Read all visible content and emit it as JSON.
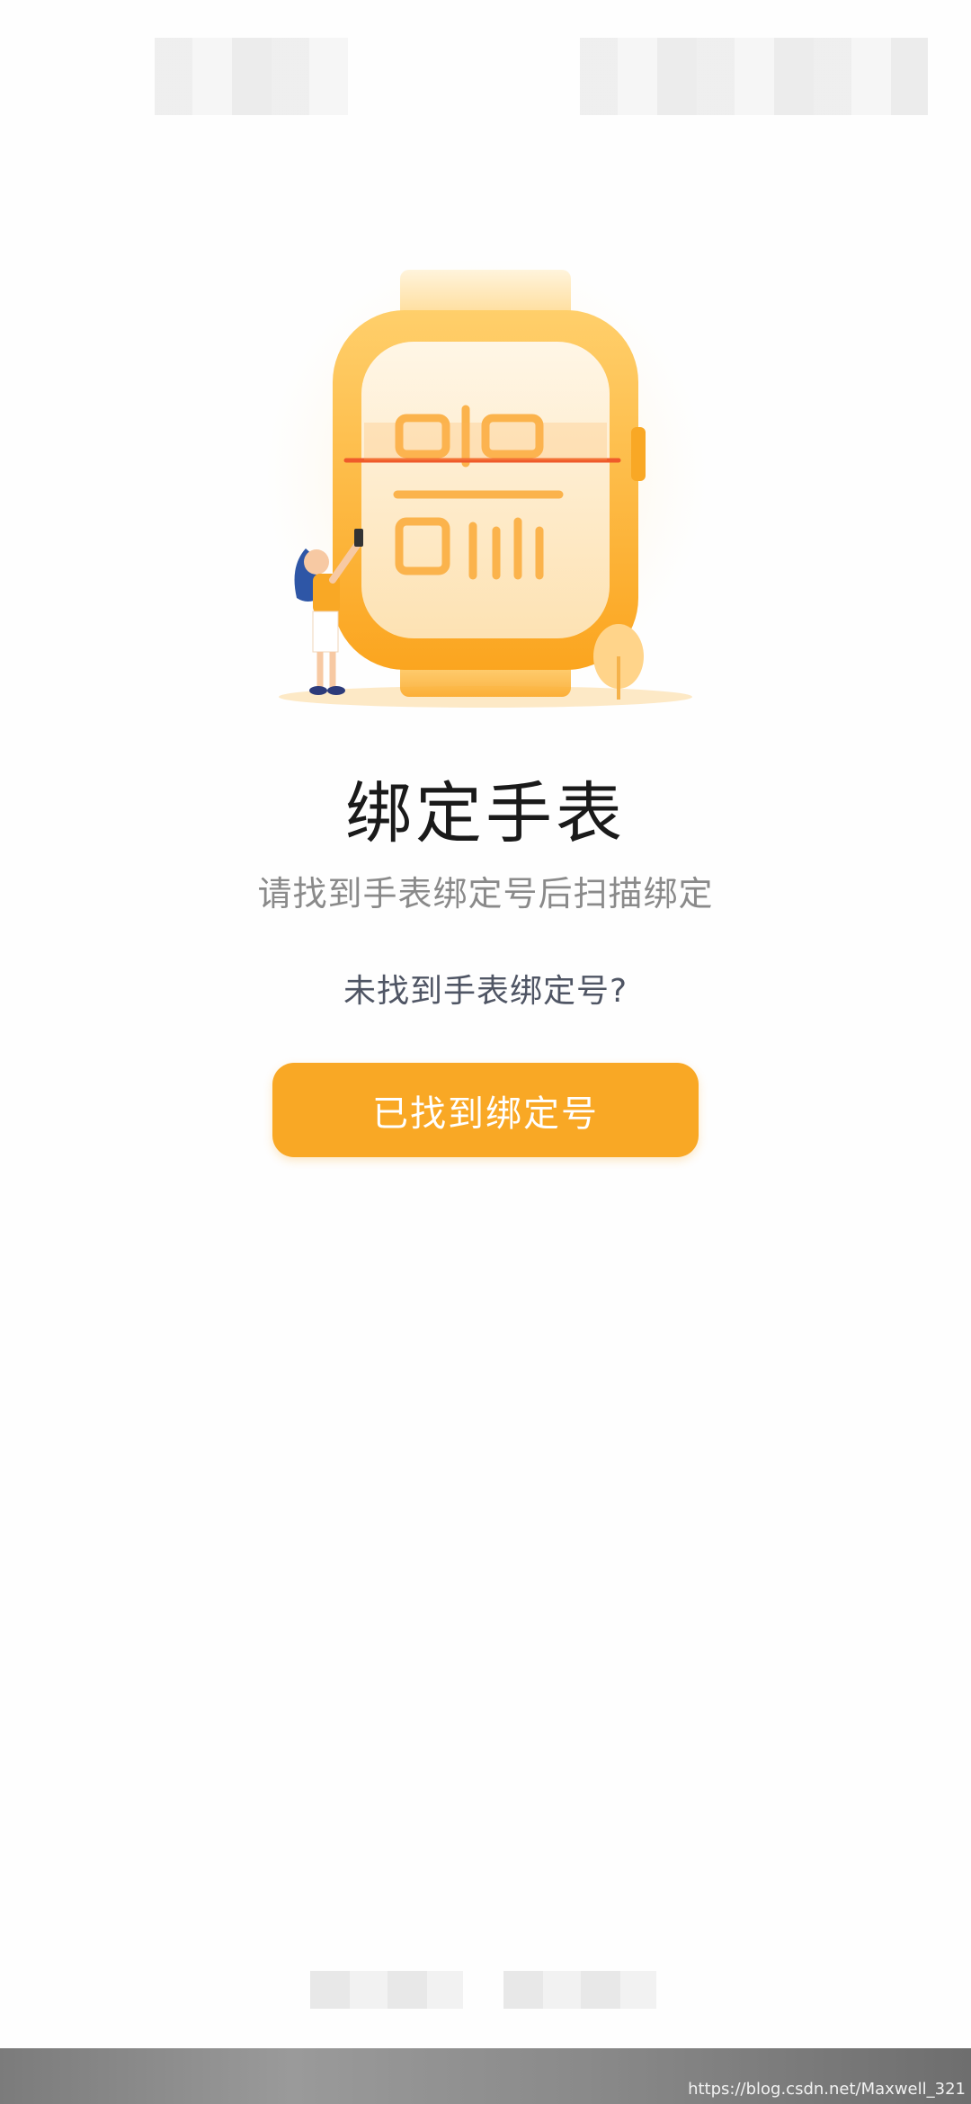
{
  "main": {
    "title": "绑定手表",
    "subtitle": "请找到手表绑定号后扫描绑定",
    "help_link": "未找到手表绑定号?",
    "primary_button": "已找到绑定号"
  },
  "footer": {
    "watermark": "https://blog.csdn.net/Maxwell_321"
  },
  "colors": {
    "accent": "#f9a825",
    "scan_line": "#ef5a2a",
    "title": "#1a1a1a",
    "subtitle": "#8a8a8a",
    "link": "#4f5564"
  },
  "icons": {
    "illustration": "watch-qr-scan-illustration"
  }
}
